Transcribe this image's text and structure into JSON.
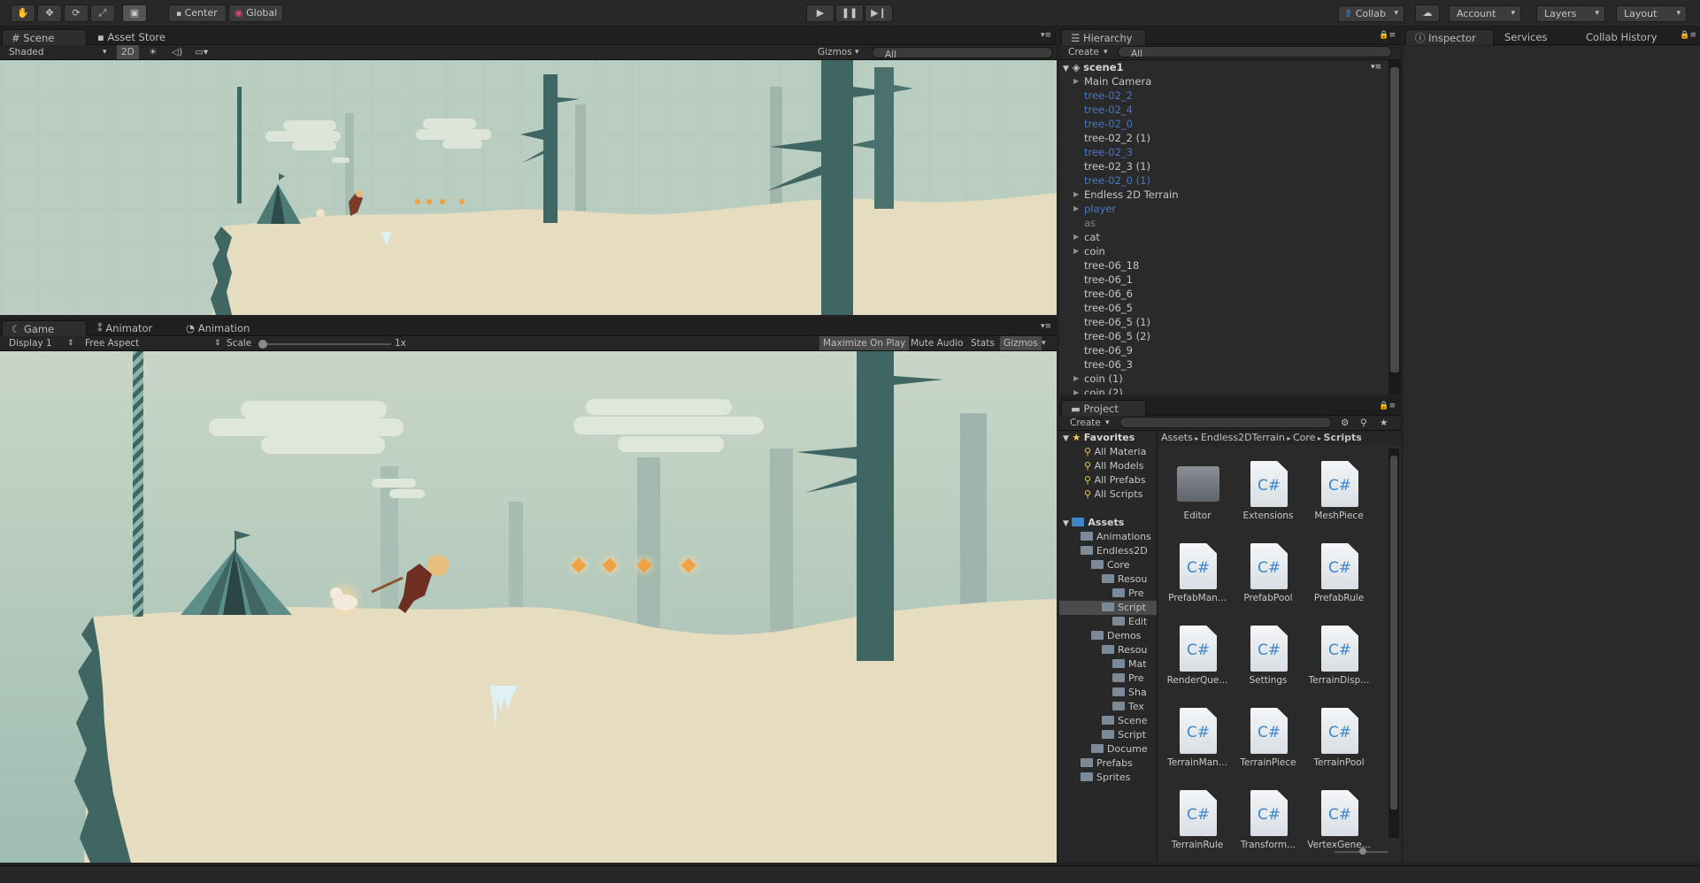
{
  "toolbar": {
    "pivot_mode": "Center",
    "pivot_rotation": "Global",
    "collab": "Collab",
    "account": "Account",
    "layers": "Layers",
    "layout": "Layout"
  },
  "scene_panel": {
    "tabs": [
      "Scene",
      "Asset Store"
    ],
    "draw_mode": "Shaded",
    "mode_2d": "2D",
    "gizmos": "Gizmos",
    "search_placeholder": "All"
  },
  "game_panel": {
    "tabs": [
      "Game",
      "Animator",
      "Animation"
    ],
    "display": "Display 1",
    "aspect": "Free Aspect",
    "scale_label": "Scale",
    "scale_value": "1x",
    "maximize_on_play": "Maximize On Play",
    "mute_audio": "Mute Audio",
    "stats": "Stats",
    "gizmos": "Gizmos"
  },
  "hierarchy": {
    "title": "Hierarchy",
    "create": "Create",
    "search_placeholder": "All",
    "scene_name": "scene1",
    "items": [
      {
        "label": "Main Camera",
        "style": "normal",
        "expandable": true
      },
      {
        "label": "tree-02_2",
        "style": "blue",
        "expandable": false
      },
      {
        "label": "tree-02_4",
        "style": "blue",
        "expandable": false
      },
      {
        "label": "tree-02_0",
        "style": "blue",
        "expandable": false
      },
      {
        "label": "tree-02_2 (1)",
        "style": "normal",
        "expandable": false
      },
      {
        "label": "tree-02_3",
        "style": "blue",
        "expandable": false
      },
      {
        "label": "tree-02_3 (1)",
        "style": "normal",
        "expandable": false
      },
      {
        "label": "tree-02_0 (1)",
        "style": "blue",
        "expandable": false
      },
      {
        "label": "Endless 2D Terrain",
        "style": "normal",
        "expandable": true
      },
      {
        "label": "player",
        "style": "blue",
        "expandable": true
      },
      {
        "label": "as",
        "style": "gray",
        "expandable": false
      },
      {
        "label": "cat",
        "style": "normal",
        "expandable": true
      },
      {
        "label": "coin",
        "style": "normal",
        "expandable": true
      },
      {
        "label": "tree-06_18",
        "style": "normal",
        "expandable": false
      },
      {
        "label": "tree-06_1",
        "style": "normal",
        "expandable": false
      },
      {
        "label": "tree-06_6",
        "style": "normal",
        "expandable": false
      },
      {
        "label": "tree-06_5",
        "style": "normal",
        "expandable": false
      },
      {
        "label": "tree-06_5 (1)",
        "style": "normal",
        "expandable": false
      },
      {
        "label": "tree-06_5 (2)",
        "style": "normal",
        "expandable": false
      },
      {
        "label": "tree-06_9",
        "style": "normal",
        "expandable": false
      },
      {
        "label": "tree-06_3",
        "style": "normal",
        "expandable": false
      },
      {
        "label": "coin (1)",
        "style": "normal",
        "expandable": true
      },
      {
        "label": "coin (2)",
        "style": "normal",
        "expandable": true
      }
    ]
  },
  "inspector": {
    "tabs": [
      "Inspector",
      "Services",
      "Collab History"
    ]
  },
  "project": {
    "title": "Project",
    "create": "Create",
    "breadcrumb": [
      "Assets",
      "Endless2DTerrain",
      "Core",
      "Scripts"
    ],
    "favorites_label": "Favorites",
    "favorites": [
      "All Materia",
      "All Models",
      "All Prefabs",
      "All Scripts"
    ],
    "assets_label": "Assets",
    "tree": [
      {
        "label": "Animations",
        "indent": 1
      },
      {
        "label": "Endless2D",
        "indent": 1
      },
      {
        "label": "Core",
        "indent": 2
      },
      {
        "label": "Resou",
        "indent": 3
      },
      {
        "label": "Pre",
        "indent": 4
      },
      {
        "label": "Script",
        "indent": 3,
        "selected": true
      },
      {
        "label": "Edit",
        "indent": 4
      },
      {
        "label": "Demos",
        "indent": 2
      },
      {
        "label": "Resou",
        "indent": 3
      },
      {
        "label": "Mat",
        "indent": 4
      },
      {
        "label": "Pre",
        "indent": 4
      },
      {
        "label": "Sha",
        "indent": 4
      },
      {
        "label": "Tex",
        "indent": 4
      },
      {
        "label": "Scene",
        "indent": 3
      },
      {
        "label": "Script",
        "indent": 3
      },
      {
        "label": "Docume",
        "indent": 2
      },
      {
        "label": "Prefabs",
        "indent": 1
      },
      {
        "label": "Sprites",
        "indent": 1
      }
    ],
    "assets": [
      {
        "label": "Editor",
        "kind": "folder"
      },
      {
        "label": "Extensions",
        "kind": "script"
      },
      {
        "label": "MeshPiece",
        "kind": "script"
      },
      {
        "label": "PrefabMan...",
        "kind": "script"
      },
      {
        "label": "PrefabPool",
        "kind": "script"
      },
      {
        "label": "PrefabRule",
        "kind": "script"
      },
      {
        "label": "RenderQue...",
        "kind": "script"
      },
      {
        "label": "Settings",
        "kind": "script"
      },
      {
        "label": "TerrainDisp...",
        "kind": "script"
      },
      {
        "label": "TerrainMan...",
        "kind": "script"
      },
      {
        "label": "TerrainPiece",
        "kind": "script"
      },
      {
        "label": "TerrainPool",
        "kind": "script"
      },
      {
        "label": "TerrainRule",
        "kind": "script"
      },
      {
        "label": "Transform...",
        "kind": "script"
      },
      {
        "label": "VertexGene...",
        "kind": "script"
      }
    ],
    "script_glyph": "C#"
  },
  "colors": {
    "sky": "#b9cdc0",
    "snow": "#e6dcbf",
    "tree": "#3f6663",
    "fog_tree": "#9fb7ad",
    "coin": "#f0a142",
    "selection_blue": "#3d6cb0"
  }
}
